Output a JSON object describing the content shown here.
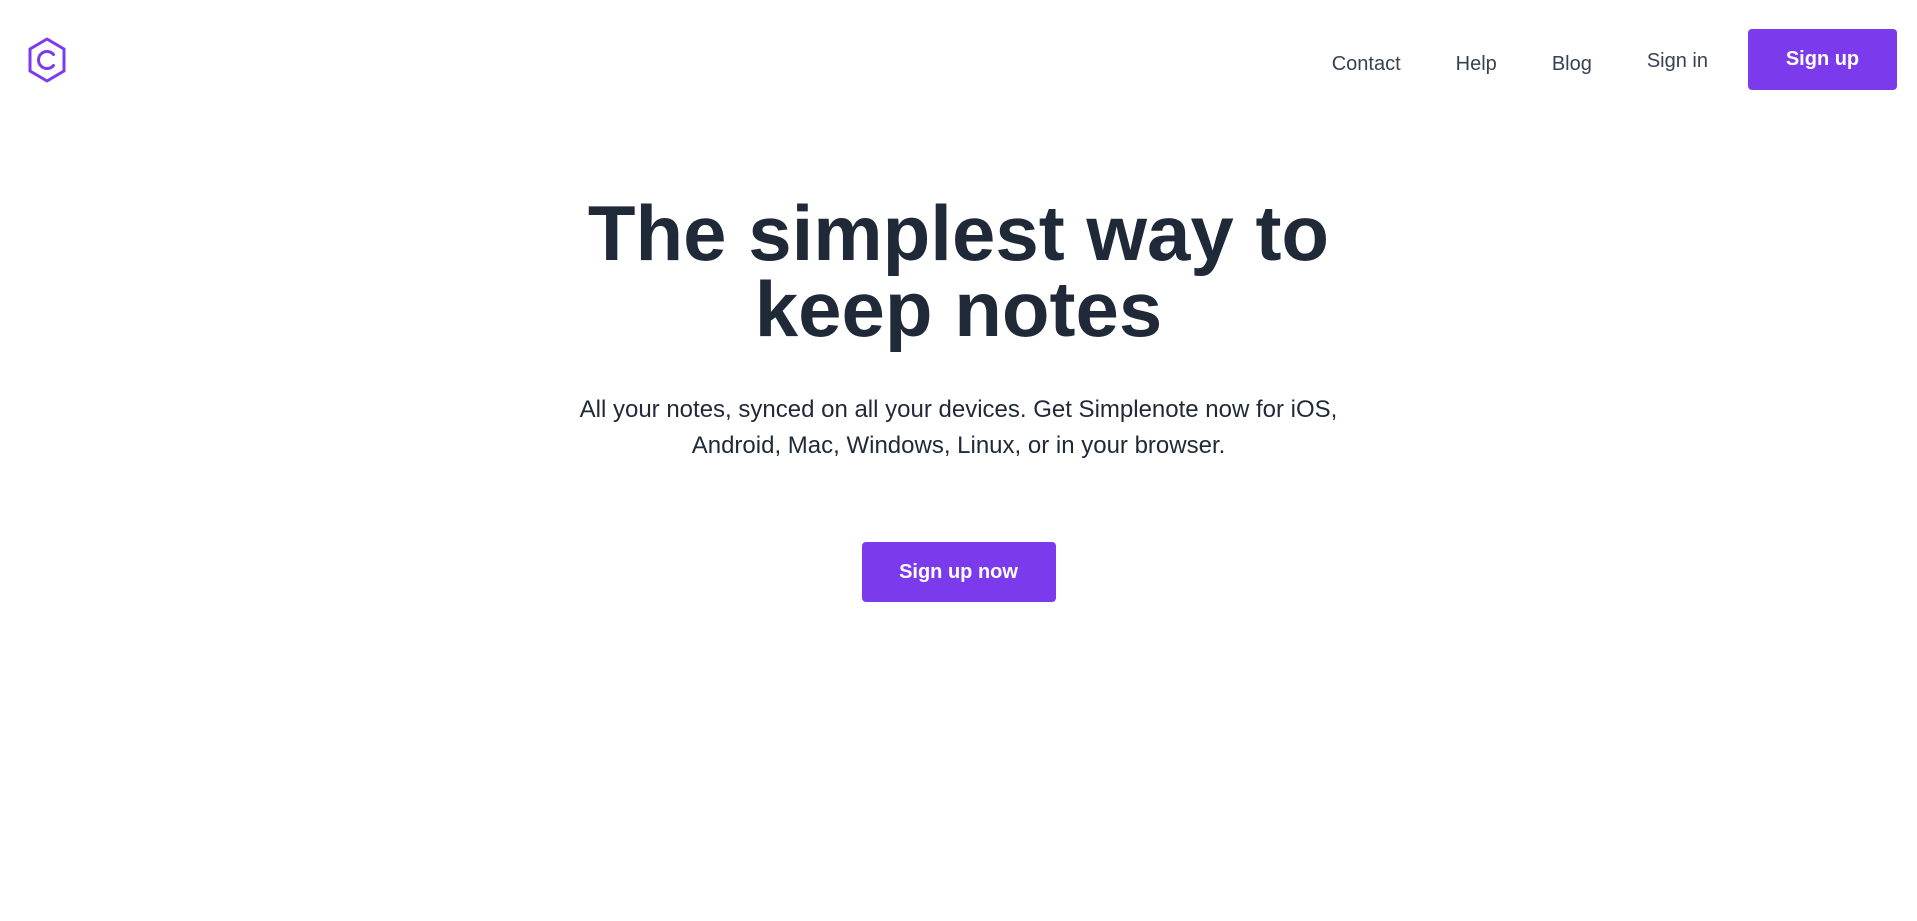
{
  "colors": {
    "accent": "#7c3aed",
    "text_dark": "#1f2937",
    "nav_text": "#374151",
    "background": "#ffffff"
  },
  "header": {
    "logo_icon": "simplenote-hexagon-logo",
    "nav": {
      "contact": "Contact",
      "help": "Help",
      "blog": "Blog",
      "sign_in": "Sign in",
      "sign_up": "Sign up"
    }
  },
  "hero": {
    "title": "The simplest way to keep notes",
    "subtitle": "All your notes, synced on all your devices. Get Simplenote now for iOS, Android, Mac, Windows, Linux, or in your browser.",
    "cta_label": "Sign up now"
  }
}
